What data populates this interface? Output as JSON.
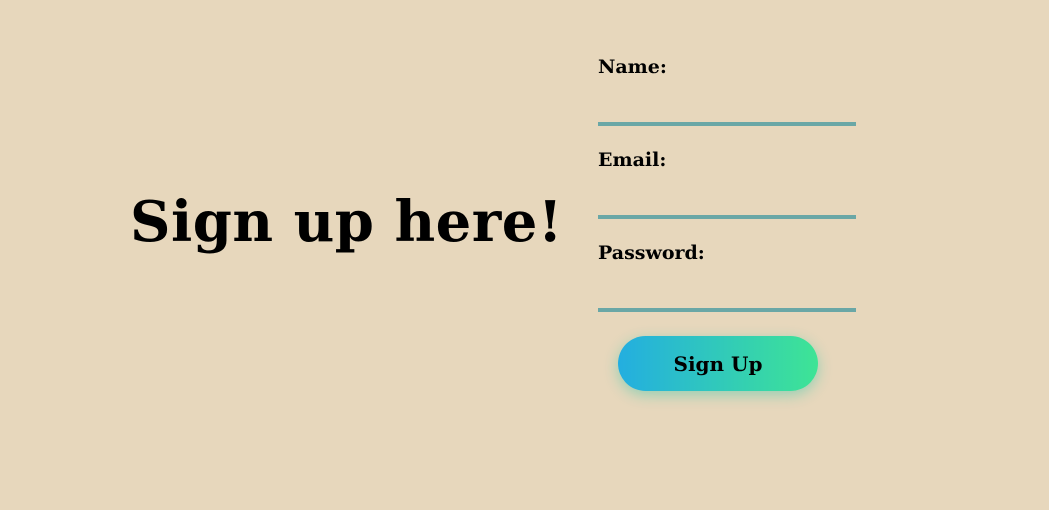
{
  "headline": "Sign up here!",
  "form": {
    "fields": [
      {
        "label": "Name:",
        "value": "",
        "placeholder": ""
      },
      {
        "label": "Email:",
        "value": "",
        "placeholder": ""
      },
      {
        "label": "Password:",
        "value": "",
        "placeholder": ""
      }
    ],
    "submit_label": "Sign Up"
  },
  "colors": {
    "background": "#e7d7bc",
    "input_underline": "#6aa7a6",
    "button_gradient_start": "#23aee0",
    "button_gradient_end": "#3ee495",
    "text": "#000000"
  }
}
